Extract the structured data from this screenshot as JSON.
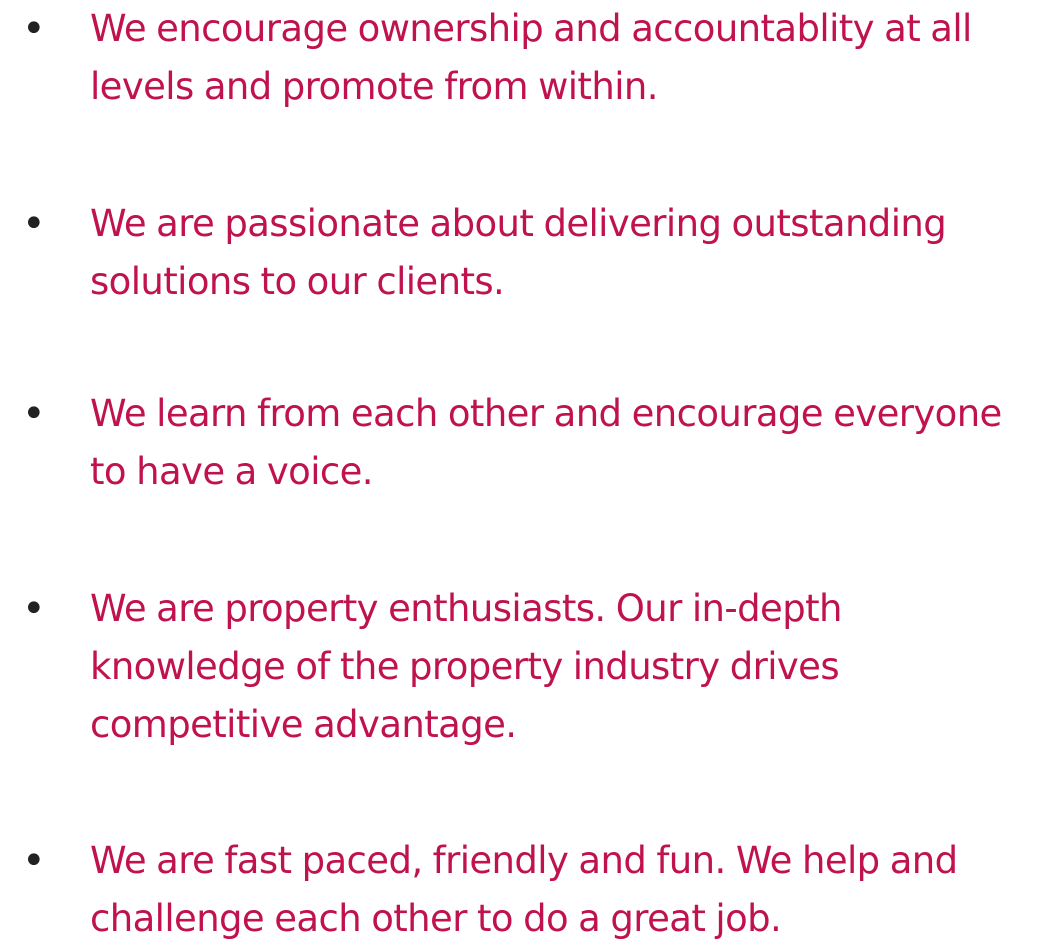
{
  "bullet_glyph": "•",
  "text_color": "#c0124f",
  "bullet_color": "#222222",
  "values": [
    {
      "text": "We encourage ownership and accountablity at all levels and promote from within."
    },
    {
      "text": "We are passionate about delivering outstanding solutions to our clients."
    },
    {
      "text": "We learn from each other and encourage everyone to have a voice."
    },
    {
      "text": "We are property enthusiasts. Our in-depth knowledge of the property industry drives competitive advantage."
    },
    {
      "text": "We are fast paced, friendly and fun. We help and challenge each other to do a great job."
    }
  ]
}
